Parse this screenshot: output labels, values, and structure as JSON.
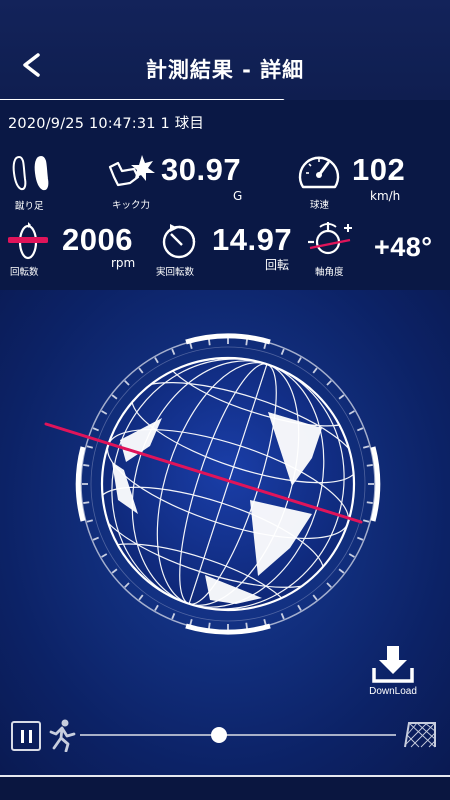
{
  "header": {
    "title": "計測結果 - 詳細",
    "back_icon": "chevron-left-icon"
  },
  "session": {
    "datetime": "2020/9/25 10:47:31",
    "kick_number": "1 球目"
  },
  "stats": {
    "kicking_foot": {
      "label": "蹴り足",
      "icon": "footprints-icon"
    },
    "kick_force": {
      "label": "キック力",
      "value": "30.97",
      "unit": "G",
      "icon": "kick-impact-icon"
    },
    "ball_speed": {
      "label": "球速",
      "value": "102",
      "unit": "km/h",
      "icon": "speedometer-icon"
    },
    "spin_rate": {
      "label": "回転数",
      "value": "2006",
      "unit": "rpm",
      "icon": "spin-axis-icon"
    },
    "actual_rotations": {
      "label": "実回転数",
      "value": "14.97",
      "unit": "回転",
      "icon": "rotation-ball-icon"
    },
    "axis_angle": {
      "label": "軸角度",
      "value": "+48°",
      "icon": "axis-angle-icon"
    }
  },
  "visualization": {
    "description_icon": "spinning-ball-icon",
    "axis_color": "#e0145a"
  },
  "download": {
    "label": "DownLoad",
    "icon": "download-icon"
  },
  "playback": {
    "pause_icon": "pause-icon",
    "start_icon": "kicker-icon",
    "end_icon": "goal-net-icon",
    "progress": 0.44
  },
  "colors": {
    "background": "#0d1a45",
    "accent": "#e0145a",
    "text": "#ffffff"
  }
}
